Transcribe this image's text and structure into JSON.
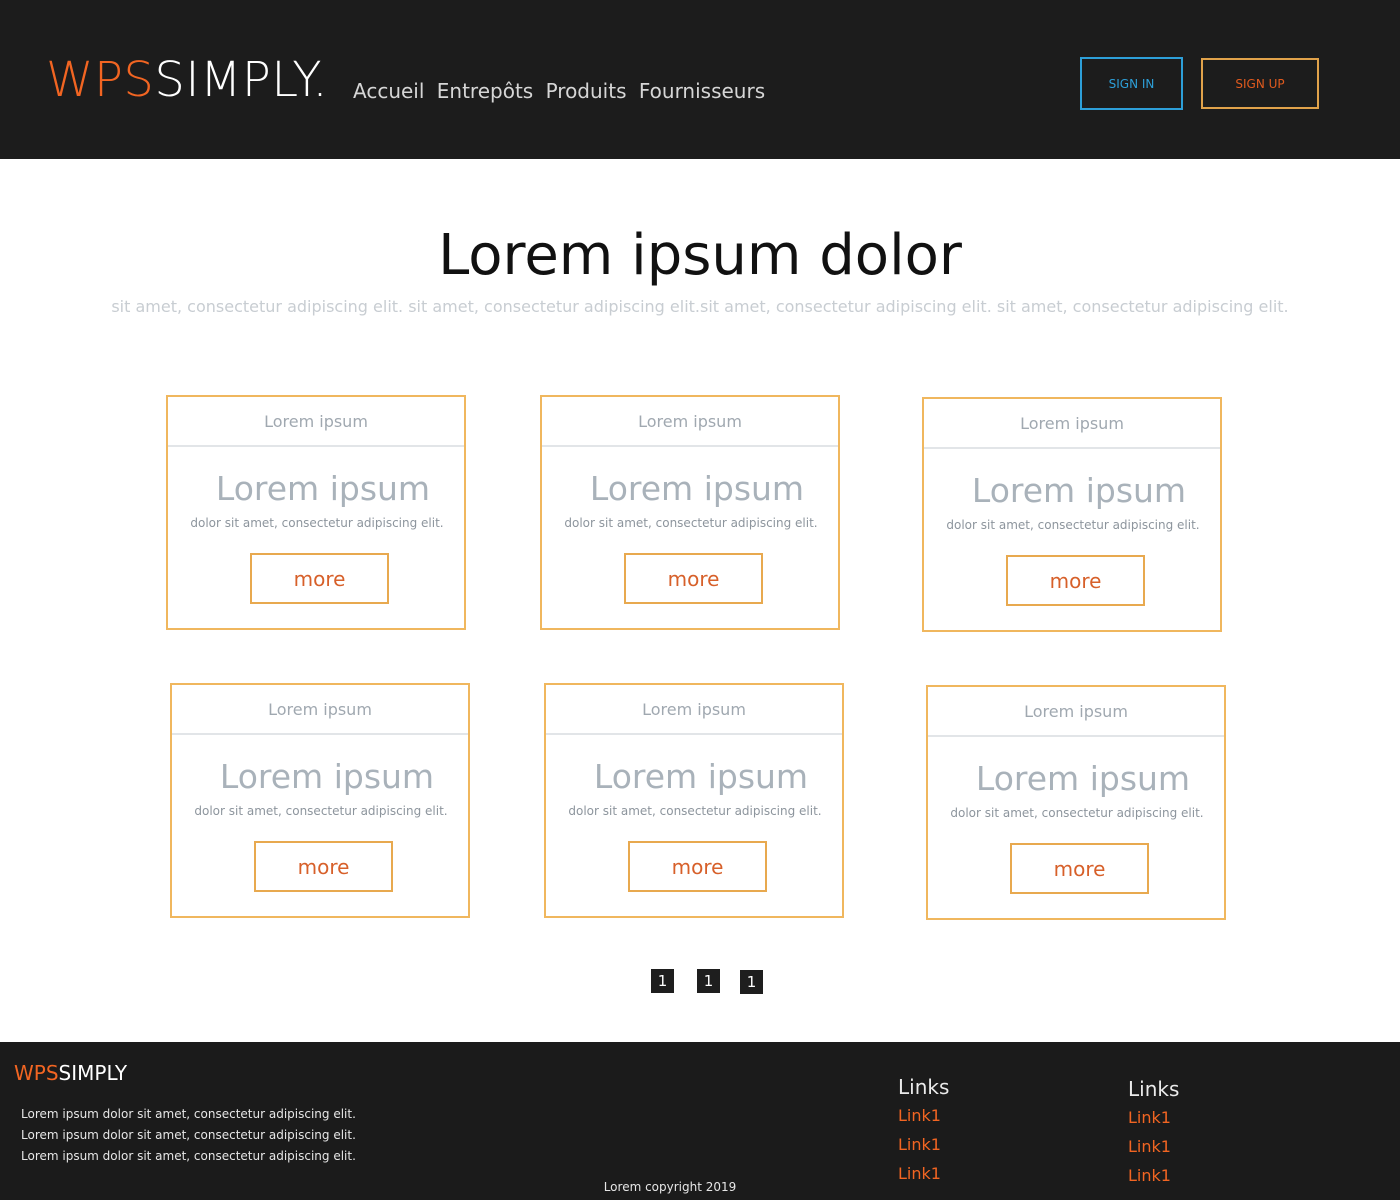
{
  "header": {
    "logo_part1": "WPS",
    "logo_part2": "SIMPLY.",
    "nav": [
      "Accueil",
      "Entrepôts",
      "Produits",
      "Fournisseurs"
    ],
    "signin_label": "SIGN IN",
    "signup_label": "SIGN UP"
  },
  "hero": {
    "title": "Lorem ipsum dolor",
    "subtitle": "sit amet, consectetur adipiscing elit. sit amet, consectetur adipiscing elit.sit amet, consectetur adipiscing elit. sit amet, consectetur adipiscing elit."
  },
  "cards": [
    {
      "header": "Lorem ipsum",
      "title": "Lorem ipsum",
      "text": "dolor sit amet, consectetur adipiscing elit.",
      "button": "more"
    },
    {
      "header": "Lorem ipsum",
      "title": "Lorem ipsum",
      "text": "dolor sit amet, consectetur adipiscing elit.",
      "button": "more"
    },
    {
      "header": "Lorem ipsum",
      "title": "Lorem ipsum",
      "text": "dolor sit amet, consectetur adipiscing elit.",
      "button": "more"
    },
    {
      "header": "Lorem ipsum",
      "title": "Lorem ipsum",
      "text": "dolor sit amet, consectetur adipiscing elit.",
      "button": "more"
    },
    {
      "header": "Lorem ipsum",
      "title": "Lorem ipsum",
      "text": "dolor sit amet, consectetur adipiscing elit.",
      "button": "more"
    },
    {
      "header": "Lorem ipsum",
      "title": "Lorem ipsum",
      "text": "dolor sit amet, consectetur adipiscing elit.",
      "button": "more"
    }
  ],
  "pagination": [
    "1",
    "1",
    "1"
  ],
  "footer": {
    "logo_part1": "WPS",
    "logo_part2": "SIMPLY",
    "lines": [
      "Lorem ipsum dolor sit amet, consectetur adipiscing elit.",
      "Lorem ipsum dolor sit amet, consectetur adipiscing elit.",
      "Lorem ipsum dolor sit amet, consectetur adipiscing elit."
    ],
    "columns": [
      {
        "heading": "Links",
        "links": [
          "Link1",
          "Link1",
          "Link1"
        ]
      },
      {
        "heading": "Links",
        "links": [
          "Link1",
          "Link1",
          "Link1"
        ]
      }
    ],
    "copyright": "Lorem copyright 2019"
  },
  "colors": {
    "brand_orange": "#f26522",
    "signin_blue": "#2d9fd8",
    "card_border": "#f0b75e",
    "dark_bg": "#1c1c1c"
  }
}
